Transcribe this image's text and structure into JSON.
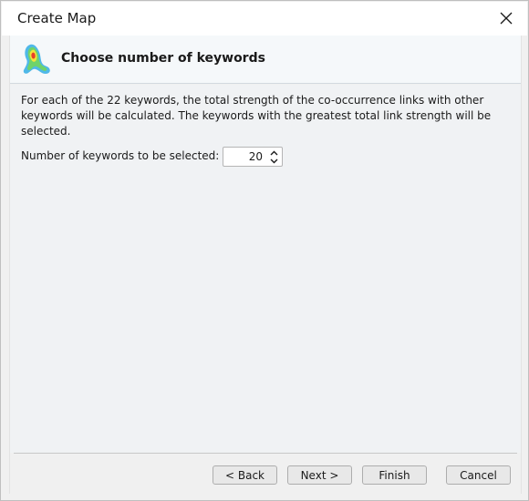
{
  "window": {
    "title": "Create Map",
    "close_icon": "close-icon"
  },
  "header": {
    "title": "Choose number of keywords",
    "logo_icon": "vosviewer-density-logo"
  },
  "content": {
    "description": "For each of the 22 keywords, the total strength of the co-occurrence links with other keywords will be calculated. The keywords with the greatest total link strength will be selected.",
    "spinner_label": "Number of keywords to be selected:",
    "spinner_value": "20"
  },
  "footer": {
    "back_label": "< Back",
    "next_label": "Next >",
    "finish_label": "Finish",
    "cancel_label": "Cancel"
  }
}
